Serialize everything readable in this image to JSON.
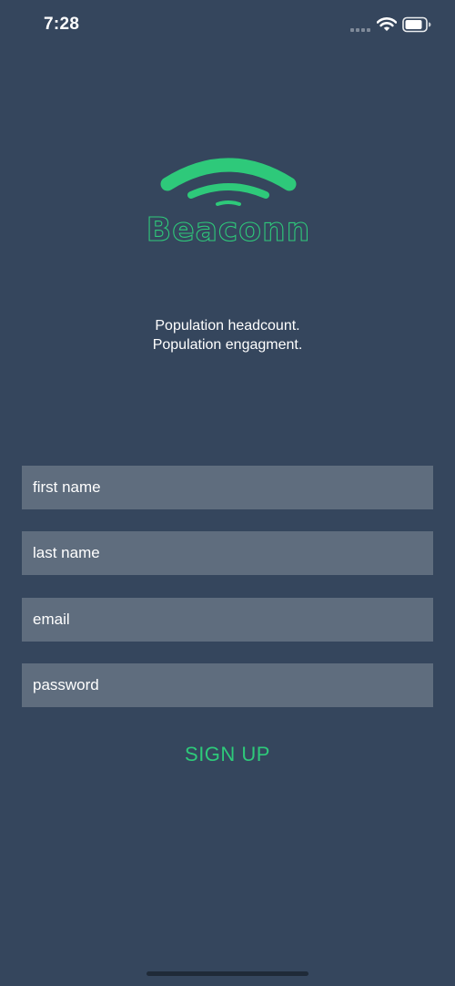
{
  "status_bar": {
    "time": "7:28",
    "icons": [
      "signal-icon",
      "wifi-icon",
      "battery-icon"
    ]
  },
  "logo": {
    "name": "Beaconn",
    "icon": "wifi-signal-logo",
    "color": "#2ec97a"
  },
  "tagline": {
    "line1": "Population headcount.",
    "line2": "Population engagment."
  },
  "form": {
    "first_name_placeholder": "first name",
    "last_name_placeholder": "last name",
    "email_placeholder": "email",
    "password_placeholder": "password",
    "signup_label": "SIGN UP"
  },
  "colors": {
    "background": "#35465d",
    "field": "#5f6d7e",
    "accent": "#2ec97a"
  }
}
